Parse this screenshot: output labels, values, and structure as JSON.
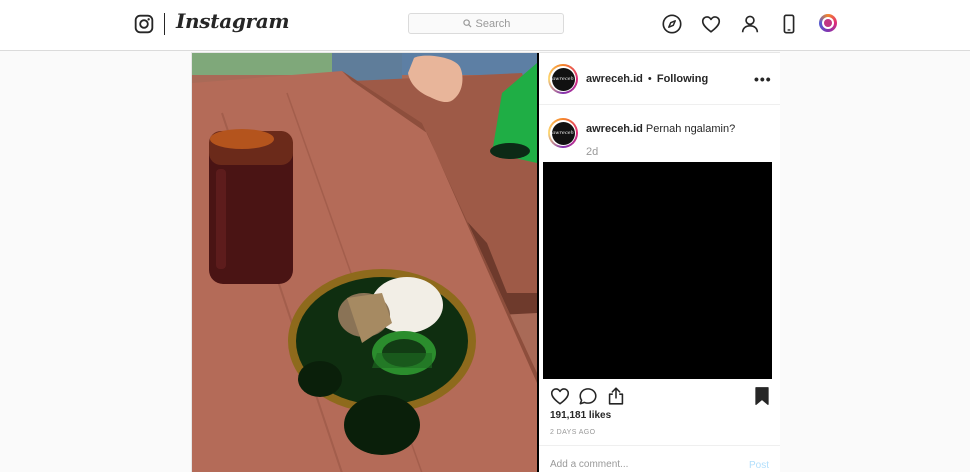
{
  "nav": {
    "wordmark": "Instagram",
    "search_placeholder": "Search",
    "icons": [
      "instagram-glyph-icon",
      "explore-compass-icon",
      "activity-heart-icon",
      "profile-user-icon",
      "mobile-phone-icon",
      "account-avatar"
    ]
  },
  "post": {
    "header": {
      "username": "awreceh.id",
      "separator": "•",
      "follow_state": "Following",
      "more_label": "•••"
    },
    "caption": {
      "username": "awreceh.id",
      "text": "Pernah ngalamin?",
      "time": "2d"
    },
    "actions": {
      "icons": [
        "like-heart-icon",
        "comment-bubble-icon",
        "share-icon",
        "save-bookmark-icon"
      ]
    },
    "likes": "191,181 likes",
    "posted_ago": "2 DAYS AGO",
    "comment": {
      "placeholder": "Add a comment...",
      "post_label": "Post"
    }
  },
  "colors": {
    "border": "#dbdbdb",
    "muted_text": "#999999",
    "post_button_disabled": "#b2dffc",
    "avatar_gradient": [
      "#f58529",
      "#dd2a7b",
      "#8134af",
      "#515bd4"
    ]
  }
}
